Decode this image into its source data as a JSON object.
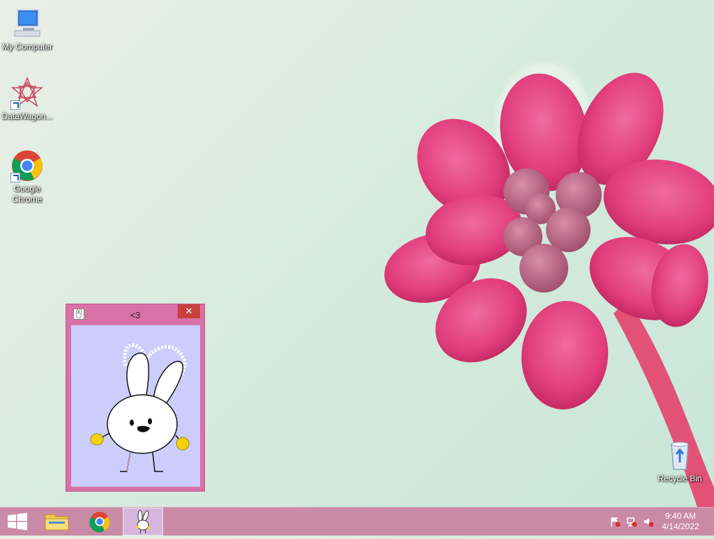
{
  "desktop": {
    "icons": [
      {
        "label": "My Computer"
      },
      {
        "label": "DataWagon..."
      },
      {
        "label": "Google Chrome"
      },
      {
        "label": "Recycle Bin"
      }
    ]
  },
  "window": {
    "title": "<3",
    "close_glyph": "✕"
  },
  "taskbar": {
    "time": "9:40 AM",
    "date": "4/14/2022"
  },
  "colors": {
    "taskbar": "#c98aa6",
    "window_frame": "#d871a6",
    "window_client": "#cccdfb",
    "close_button": "#c7413f",
    "flower": "#e9407f"
  }
}
